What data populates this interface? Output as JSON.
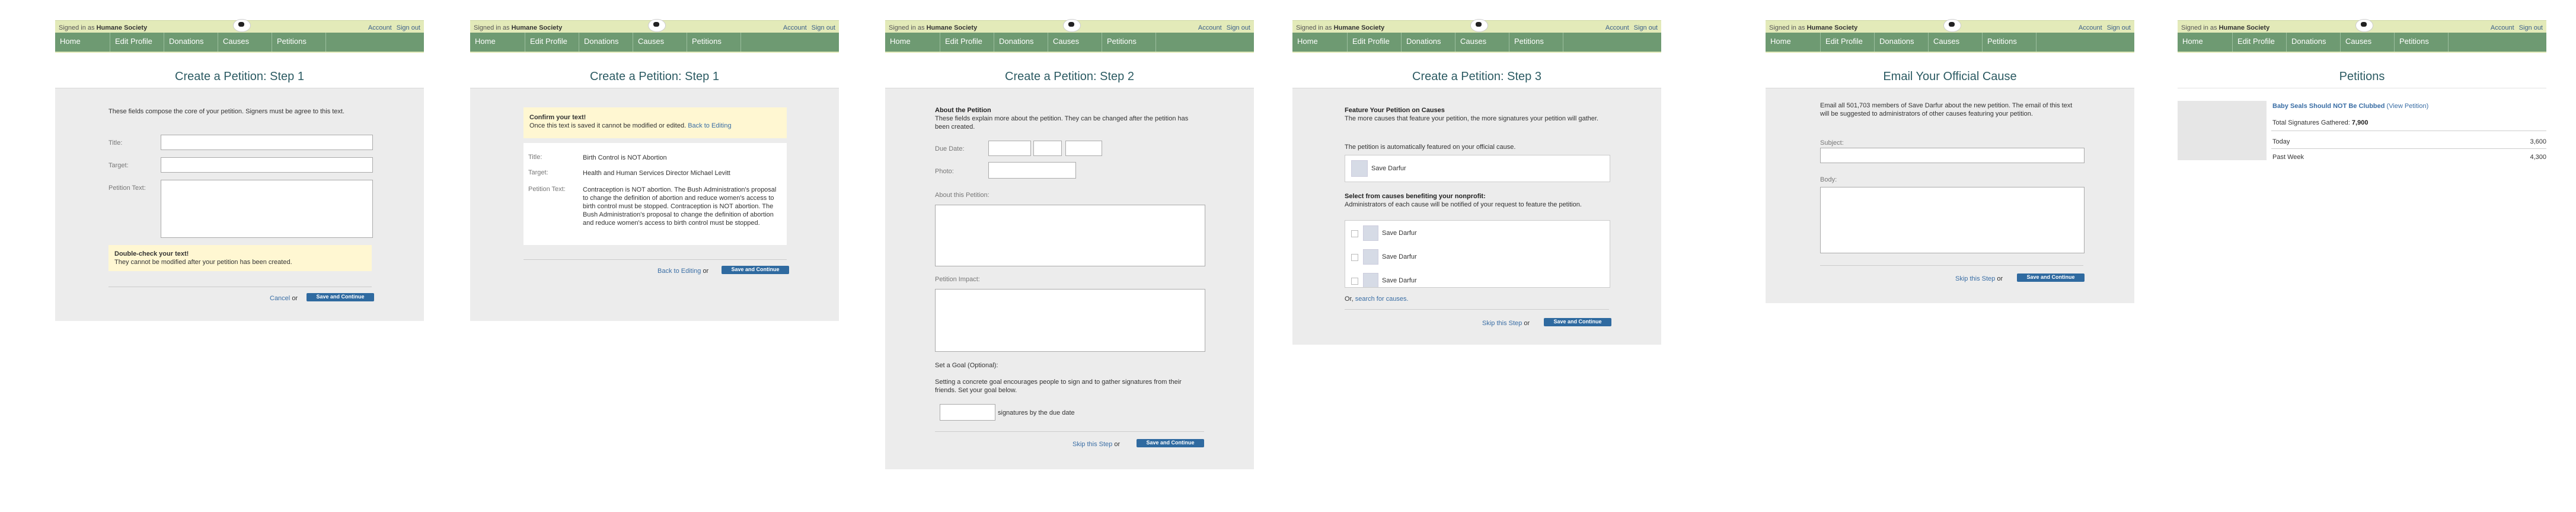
{
  "header": {
    "signed_in": "Signed in as",
    "org": "Humane Society",
    "account": "Account",
    "sign_out": "Sign out",
    "nav": [
      "Home",
      "Edit Profile",
      "Donations",
      "Causes",
      "Petitions"
    ]
  },
  "p1": {
    "title": "Create a Petition: Step 1",
    "intro": "These fields compose the core of your petition. Signers must be agree to this text.",
    "f_title": "Title:",
    "f_target": "Target:",
    "f_text": "Petition Text:",
    "warn_head": "Double-check your text!",
    "warn_body": "They cannot be modified after your petition has been created.",
    "cancel": "Cancel",
    "or": "or",
    "save": "Save and Continue"
  },
  "p2": {
    "title": "Create a Petition: Step 1",
    "confirm_head": "Confirm your text!",
    "confirm_body": "Once this text is saved it cannot be modified or edited.",
    "back_link": "Back to Editing",
    "l_title": "Title:",
    "v_title": "Birth Control is NOT Abortion",
    "l_target": "Target:",
    "v_target": "Health and Human Services Director Michael Levitt",
    "l_text": "Petition Text:",
    "v_text": "Contraception is NOT abortion. The Bush Administration's proposal to change the definition of abortion and reduce women's access to birth control must be stopped. Contraception is NOT abortion. The Bush Administration's proposal to change the definition of abortion and reduce women's access to birth control must be stopped.",
    "back_bottom": "Back to Editing",
    "or": "or",
    "save": "Save and Continue"
  },
  "p3": {
    "title": "Create a Petition: Step 2",
    "about_head": "About the Petition",
    "about_body": "These fields explain more about the petition. They can be changed after the petition has been created.",
    "due": "Due Date:",
    "photo": "Photo:",
    "about_this": "About this Petition:",
    "impact": "Petition Impact:",
    "goal_head": "Set a Goal (Optional):",
    "goal_body": "Setting a concrete goal encourages people to sign and to gather signatures from their friends. Set your goal below.",
    "sig_suffix": "signatures by the due date",
    "skip": "Skip this Step",
    "or": "or",
    "save": "Save and Continue"
  },
  "p4": {
    "title": "Create a Petition: Step 3",
    "feat_head": "Feature Your Petition on Causes",
    "feat_body": "The more causes that feature your petition, the more signatures your petition will gather.",
    "auto": "The petition is automatically featured on your official cause.",
    "official_cause": "Save Darfur",
    "select_head": "Select from causes benefiting your nonprofit:",
    "select_body": "Administrators of each cause will be notified of your request to feature the petition.",
    "causes": [
      "Save Darfur",
      "Save Darfur",
      "Save Darfur"
    ],
    "or_prefix": "Or,",
    "search_link": "search for causes.",
    "skip": "Skip this Step",
    "or": "or",
    "save": "Save and Continue"
  },
  "p5": {
    "title": "Email Your Official Cause",
    "intro": "Email all 501,703 members of Save Darfur about the new petition. The email of this text will be suggested to administrators of other causes featuring your petition.",
    "subject": "Subject:",
    "body": "Body:",
    "skip": "Skip this Step",
    "or": "or",
    "save": "Save and Continue"
  },
  "p6": {
    "title": "Petitions",
    "petition_link": "Baby Seals Should NOT Be Clubbed",
    "view_link": "(View Petition)",
    "total_label": "Total Signatures Gathered:",
    "total_value": "7,900",
    "rows": [
      {
        "label": "Today",
        "value": "3,600"
      },
      {
        "label": "Past Week",
        "value": "4,300"
      }
    ]
  },
  "colors": {
    "nav_green": "#6e9a72",
    "top_bar": "#e3eab9",
    "title_teal": "#2c5b63",
    "button_blue": "#2f6aa0",
    "note_yellow": "#fff7d2"
  }
}
